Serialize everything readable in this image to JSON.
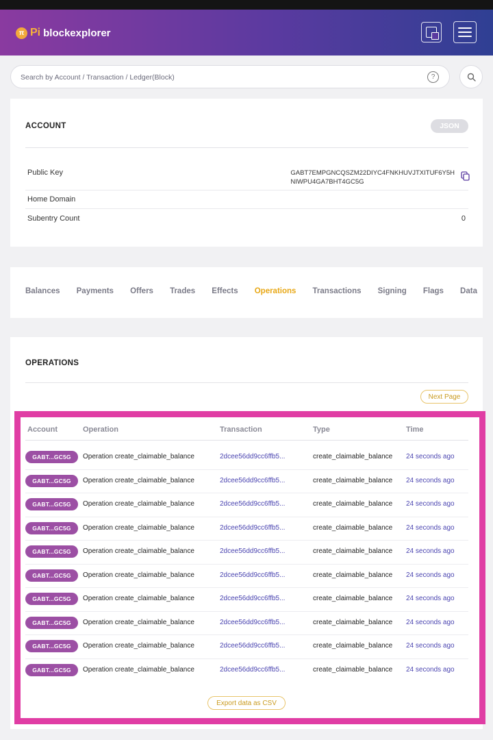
{
  "header": {
    "logo_pi": "Pi",
    "logo_rest": "blockexplorer",
    "translate_icon": "translate-icon",
    "menu_icon": "hamburger-menu-icon"
  },
  "search": {
    "placeholder": "Search by Account / Transaction / Ledger(Block)",
    "help_glyph": "?"
  },
  "account": {
    "title": "ACCOUNT",
    "json_label": "JSON",
    "public_key_label": "Public Key",
    "public_key_line1": "GABT7EMPGNCQSZM22DIYC4FNKHUVJTXITUF6Y5H",
    "public_key_line2": "NIWPU4GA7BHT4GC5G",
    "home_domain_label": "Home Domain",
    "home_domain_value": "",
    "subentry_label": "Subentry Count",
    "subentry_value": "0"
  },
  "tabs": [
    "Balances",
    "Payments",
    "Offers",
    "Trades",
    "Effects",
    "Operations",
    "Transactions",
    "Signing",
    "Flags",
    "Data"
  ],
  "active_tab": "Operations",
  "operations": {
    "title": "OPERATIONS",
    "next_page": "Next Page",
    "columns": [
      "Account",
      "Operation",
      "Transaction",
      "Type",
      "Time"
    ],
    "rows": [
      {
        "account": "GABT...GC5G",
        "operation": "Operation create_claimable_balance",
        "transaction": "2dcee56dd9cc6ffb5...",
        "type": "create_claimable_balance",
        "time": "24 seconds ago"
      },
      {
        "account": "GABT...GC5G",
        "operation": "Operation create_claimable_balance",
        "transaction": "2dcee56dd9cc6ffb5...",
        "type": "create_claimable_balance",
        "time": "24 seconds ago"
      },
      {
        "account": "GABT...GC5G",
        "operation": "Operation create_claimable_balance",
        "transaction": "2dcee56dd9cc6ffb5...",
        "type": "create_claimable_balance",
        "time": "24 seconds ago"
      },
      {
        "account": "GABT...GC5G",
        "operation": "Operation create_claimable_balance",
        "transaction": "2dcee56dd9cc6ffb5...",
        "type": "create_claimable_balance",
        "time": "24 seconds ago"
      },
      {
        "account": "GABT...GC5G",
        "operation": "Operation create_claimable_balance",
        "transaction": "2dcee56dd9cc6ffb5...",
        "type": "create_claimable_balance",
        "time": "24 seconds ago"
      },
      {
        "account": "GABT...GC5G",
        "operation": "Operation create_claimable_balance",
        "transaction": "2dcee56dd9cc6ffb5...",
        "type": "create_claimable_balance",
        "time": "24 seconds ago"
      },
      {
        "account": "GABT...GC5G",
        "operation": "Operation create_claimable_balance",
        "transaction": "2dcee56dd9cc6ffb5...",
        "type": "create_claimable_balance",
        "time": "24 seconds ago"
      },
      {
        "account": "GABT...GC5G",
        "operation": "Operation create_claimable_balance",
        "transaction": "2dcee56dd9cc6ffb5...",
        "type": "create_claimable_balance",
        "time": "24 seconds ago"
      },
      {
        "account": "GABT...GC5G",
        "operation": "Operation create_claimable_balance",
        "transaction": "2dcee56dd9cc6ffb5...",
        "type": "create_claimable_balance",
        "time": "24 seconds ago"
      },
      {
        "account": "GABT...GC5G",
        "operation": "Operation create_claimable_balance",
        "transaction": "2dcee56dd9cc6ffb5...",
        "type": "create_claimable_balance",
        "time": "24 seconds ago"
      }
    ],
    "export_csv": "Export data as CSV"
  },
  "colors": {
    "accent_gold": "#e8a817",
    "pill_purple": "#9c4fa4",
    "link_blue": "#4a44b0",
    "highlight_pink": "#e03da4"
  }
}
